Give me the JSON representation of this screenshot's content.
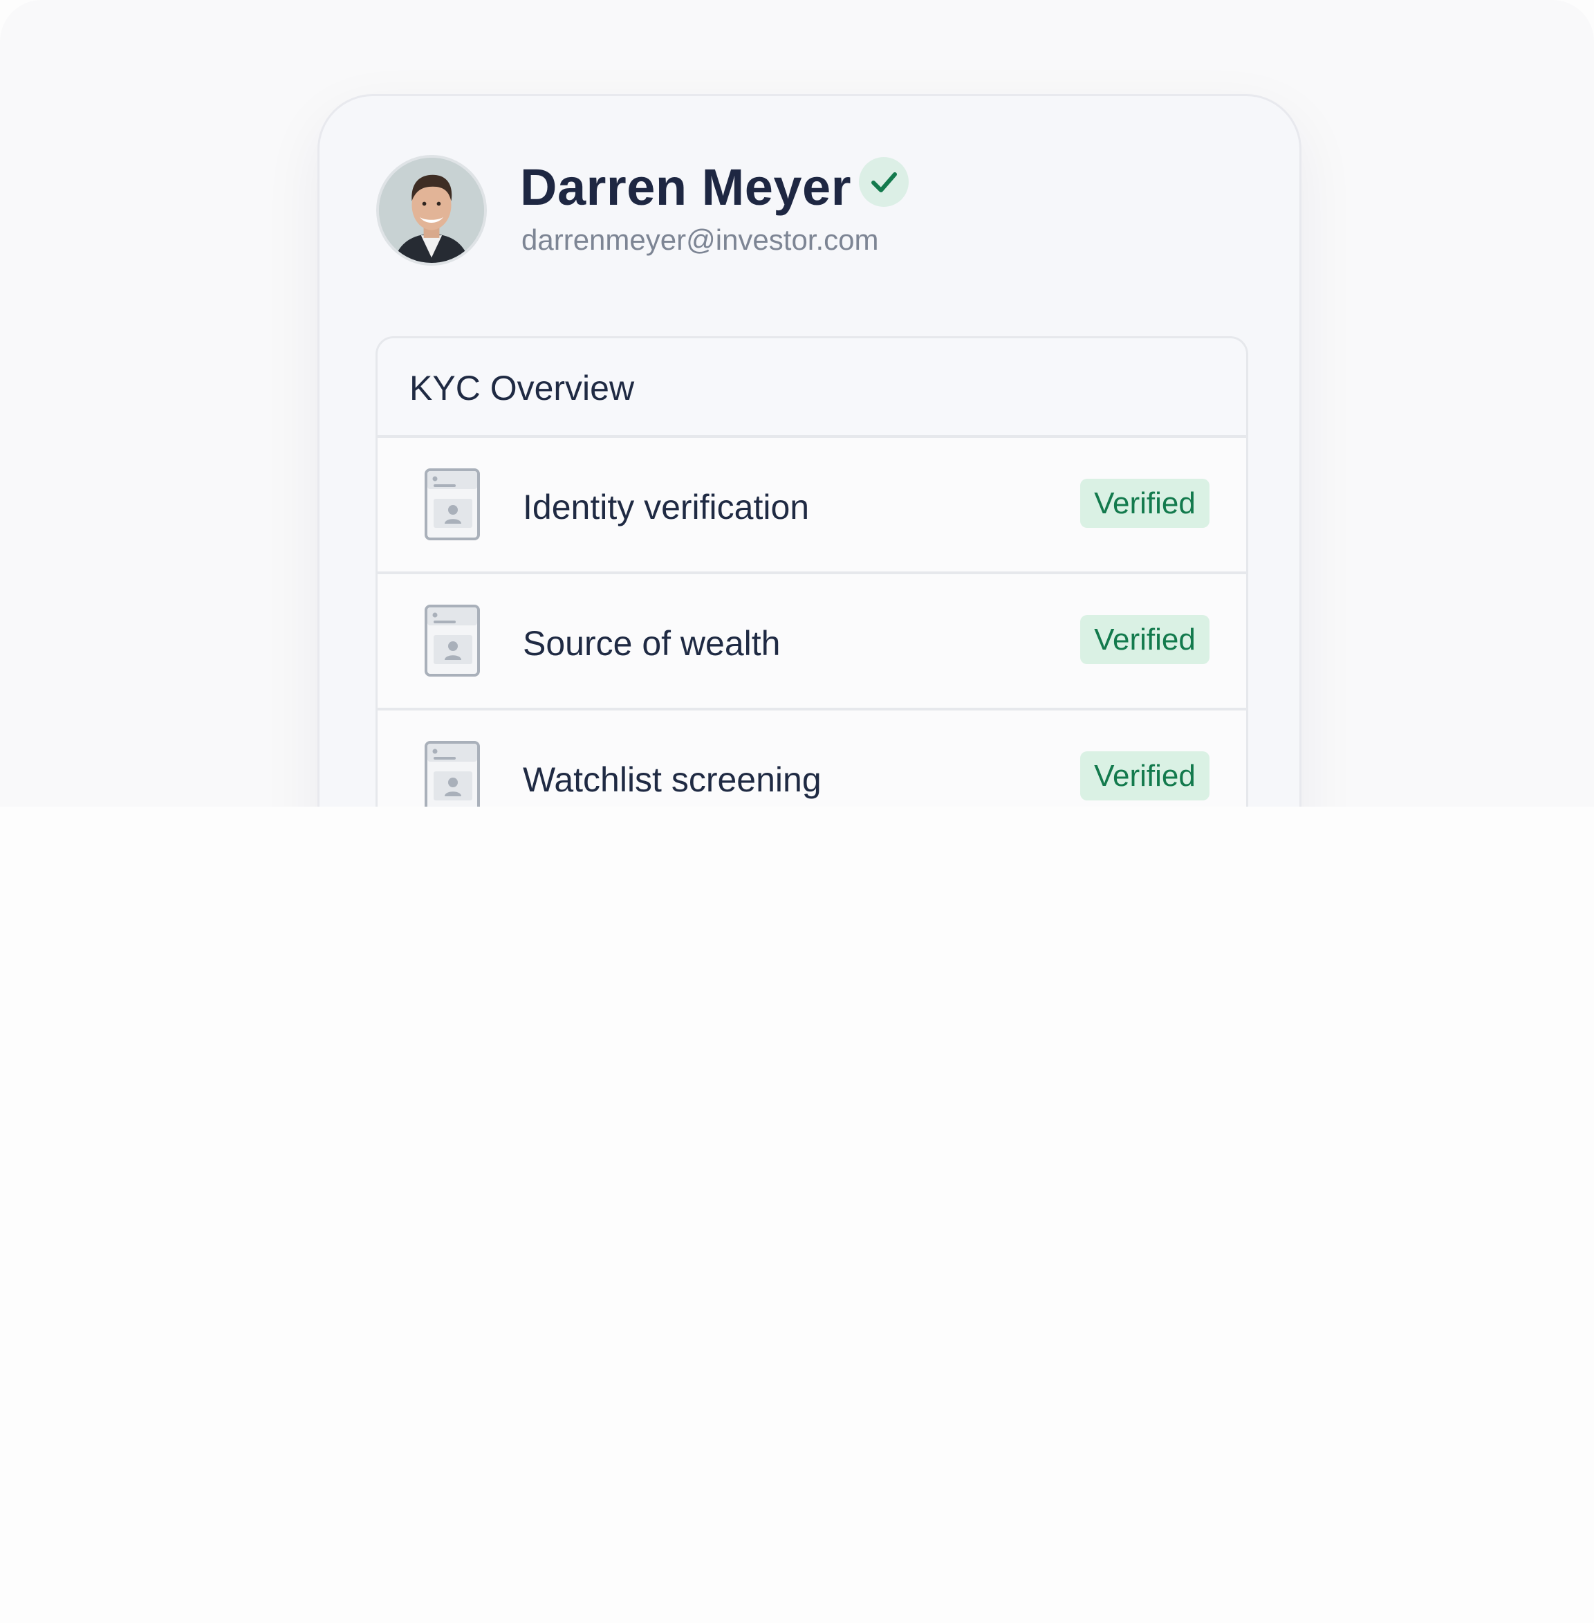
{
  "profile": {
    "name": "Darren Meyer",
    "email": "darrenmeyer@investor.com",
    "verified_icon": "check-icon"
  },
  "kyc": {
    "title": "KYC Overview",
    "items": [
      {
        "label": "Identity verification",
        "status": "Verified",
        "icon": "id-document-icon"
      },
      {
        "label": "Source of wealth",
        "status": "Verified",
        "icon": "id-document-icon"
      },
      {
        "label": "Watchlist screening",
        "status": "Verified",
        "icon": "id-document-icon"
      }
    ]
  },
  "colors": {
    "text_primary": "#1f2a43",
    "text_secondary": "#7d8594",
    "badge_background": "#daf1e4",
    "badge_text": "#137a4d",
    "check_background": "#dcefe6",
    "check_stroke": "#137a4d"
  }
}
